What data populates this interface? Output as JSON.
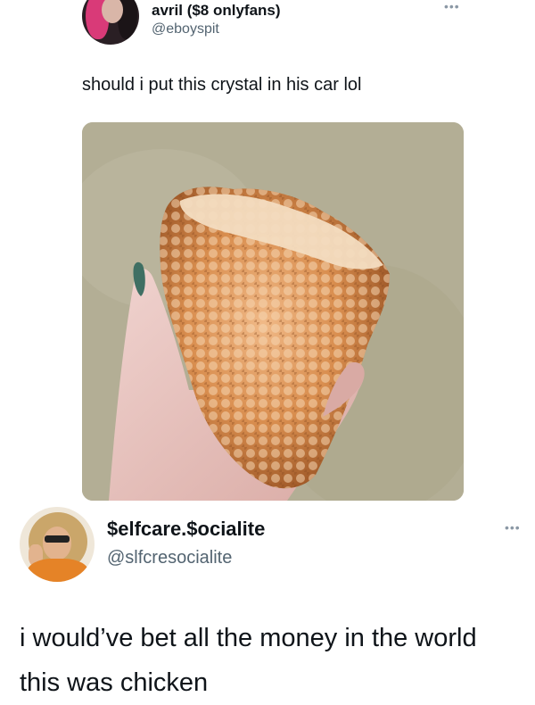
{
  "tweet1": {
    "display_name": "avril ($8 onlyfans)",
    "handle": "@eboyspit",
    "text": "should i put this crystal in his car lol",
    "more_icon": "ellipsis-icon",
    "media": {
      "subject": "hand holding an orange quartz crystal cluster",
      "colors": {
        "background": "#b3ae95",
        "crystal": "#d98e4f",
        "crystal_light": "#f2c8a0",
        "skin": "#e9c7c2",
        "nail": "#3f6f63"
      }
    }
  },
  "tweet2": {
    "display_name": "$elfcare.$ocialite",
    "handle": "@slfcresocialite",
    "text": "i would’ve bet all the money in the world this was chicken",
    "more_icon": "ellipsis-icon"
  },
  "colors": {
    "text_primary": "#0f1419",
    "text_secondary": "#536471",
    "icon_muted": "#8b98a5"
  }
}
